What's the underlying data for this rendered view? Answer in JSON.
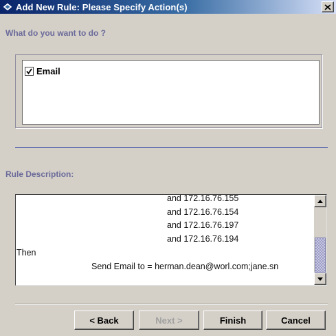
{
  "window": {
    "title": "Add New Rule: Please Specify Action(s)",
    "icon": "rule-icon",
    "close_icon": "close-icon"
  },
  "actions_section": {
    "heading": "What do you want to do ?",
    "items": [
      {
        "label": "Email",
        "checked": true
      }
    ]
  },
  "description_section": {
    "heading": "Rule Description:",
    "lines": [
      "and 172.16.76.155",
      "and 172.16.76.154",
      "and 172.16.76.197",
      "and 172.16.76.194",
      "Then",
      "Send Email to = herman.dean@worl.com;jane.sn"
    ]
  },
  "buttons": {
    "back": "< Back",
    "next": "Next >",
    "finish": "Finish",
    "cancel": "Cancel"
  },
  "colors": {
    "title_gradient_start": "#0a246a",
    "title_gradient_end": "#d6dff7",
    "section_label": "#6b6a9a",
    "dialog_bg": "#d4d0c8"
  }
}
